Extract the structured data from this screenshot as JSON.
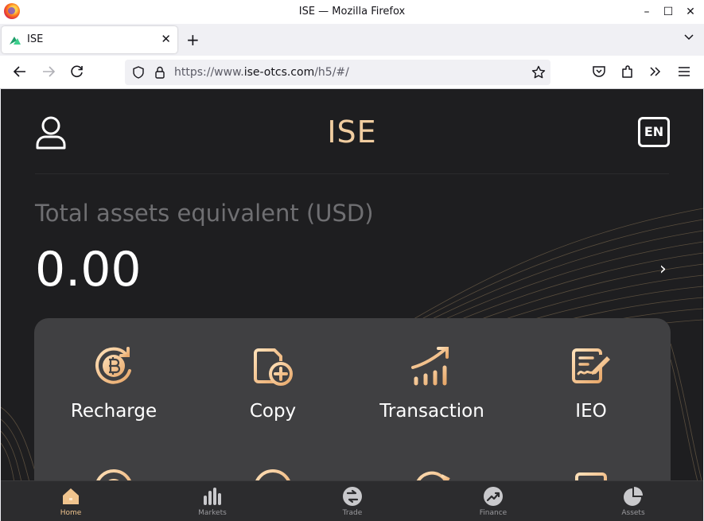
{
  "window": {
    "title": "ISE — Mozilla Firefox",
    "minimize": "–",
    "maximize": "☐",
    "close": "✕"
  },
  "tab": {
    "title": "ISE",
    "close": "✕",
    "new_tab": "+"
  },
  "url": {
    "prefix": "https://www.",
    "host": "ise-otcs.com",
    "path": "/h5/#/"
  },
  "app": {
    "title": "ISE",
    "lang": "EN"
  },
  "assets": {
    "label": "Total assets equivalent (USD)",
    "value": "0.00",
    "chevron": "›"
  },
  "grid": [
    {
      "label": "Recharge",
      "icon": "bitcoin-recharge-icon"
    },
    {
      "label": "Copy",
      "icon": "copy-add-icon"
    },
    {
      "label": "Transaction",
      "icon": "chart-up-icon"
    },
    {
      "label": "IEO",
      "icon": "document-sign-icon"
    }
  ],
  "bottom_nav": [
    {
      "label": "Home",
      "icon": "home-icon",
      "active": true
    },
    {
      "label": "Markets",
      "icon": "bar-chart-icon"
    },
    {
      "label": "Trade",
      "icon": "trade-icon"
    },
    {
      "label": "Finance",
      "icon": "finance-icon"
    },
    {
      "label": "Assets",
      "icon": "pie-chart-icon"
    }
  ],
  "colors": {
    "accent": "#f1cda0",
    "page_bg": "#1e1e20",
    "card_bg": "#404042",
    "nav_bg": "#2c2c2e"
  }
}
